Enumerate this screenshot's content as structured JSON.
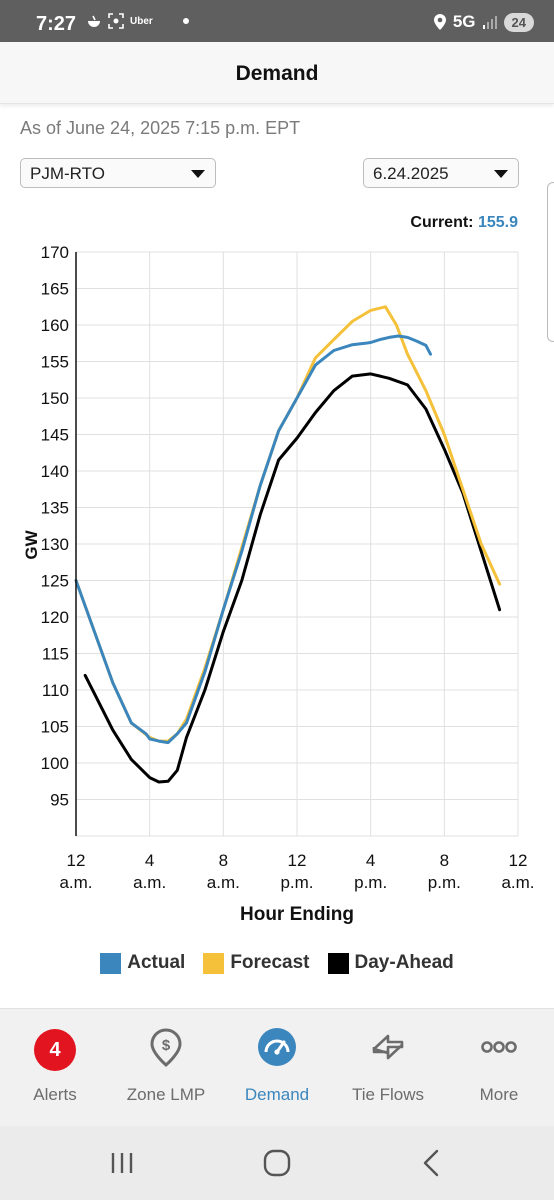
{
  "status_bar": {
    "time": "7:27",
    "uber": "Uber",
    "network": "5G",
    "battery": "24"
  },
  "header": {
    "title": "Demand"
  },
  "as_of": "As of June 24, 2025 7:15 p.m. EPT",
  "filters": {
    "region": "PJM-RTO",
    "date": "6.24.2025"
  },
  "current": {
    "label": "Current:",
    "value": "155.9"
  },
  "chart_data": {
    "type": "line",
    "xlabel": "Hour Ending",
    "ylabel": "GW",
    "ylim": [
      90,
      170
    ],
    "xlim": [
      0,
      24
    ],
    "yticks": [
      95,
      100,
      105,
      110,
      115,
      120,
      125,
      130,
      135,
      140,
      145,
      150,
      155,
      160,
      165,
      170
    ],
    "xticks": [
      {
        "x": 0,
        "line1": "12",
        "line2": "a.m."
      },
      {
        "x": 4,
        "line1": "4",
        "line2": "a.m."
      },
      {
        "x": 8,
        "line1": "8",
        "line2": "a.m."
      },
      {
        "x": 12,
        "line1": "12",
        "line2": "p.m."
      },
      {
        "x": 16,
        "line1": "4",
        "line2": "p.m."
      },
      {
        "x": 20,
        "line1": "8",
        "line2": "p.m."
      },
      {
        "x": 24,
        "line1": "12",
        "line2": "a.m."
      }
    ],
    "grid": true,
    "legend_position": "bottom",
    "series": [
      {
        "name": "Day-Ahead",
        "color": "#000000",
        "points": [
          [
            0.5,
            112
          ],
          [
            1,
            109.5
          ],
          [
            2,
            104.5
          ],
          [
            3,
            100.5
          ],
          [
            4,
            98
          ],
          [
            4.5,
            97.4
          ],
          [
            5,
            97.5
          ],
          [
            5.5,
            99
          ],
          [
            6,
            103.5
          ],
          [
            7,
            110
          ],
          [
            8,
            118
          ],
          [
            9,
            125
          ],
          [
            10,
            134
          ],
          [
            11,
            141.5
          ],
          [
            12,
            144.5
          ],
          [
            13,
            148
          ],
          [
            14,
            151
          ],
          [
            15,
            153
          ],
          [
            16,
            153.3
          ],
          [
            17,
            152.7
          ],
          [
            18,
            151.8
          ],
          [
            19,
            148.5
          ],
          [
            20,
            143
          ],
          [
            21,
            137
          ],
          [
            22,
            129
          ],
          [
            23,
            121
          ]
        ]
      },
      {
        "name": "Forecast",
        "color": "#f5c13a",
        "points": [
          [
            0,
            125
          ],
          [
            1,
            118
          ],
          [
            2,
            111
          ],
          [
            3,
            105.5
          ],
          [
            4,
            103.5
          ],
          [
            4.5,
            103
          ],
          [
            5,
            103
          ],
          [
            5.5,
            104
          ],
          [
            6,
            106
          ],
          [
            7,
            113
          ],
          [
            8,
            121
          ],
          [
            9,
            129.5
          ],
          [
            10,
            138
          ],
          [
            11,
            145.5
          ],
          [
            12,
            150
          ],
          [
            13,
            155.5
          ],
          [
            14,
            158
          ],
          [
            15,
            160.5
          ],
          [
            16,
            162
          ],
          [
            16.8,
            162.5
          ],
          [
            17.4,
            160
          ],
          [
            18,
            156
          ],
          [
            19,
            151
          ],
          [
            20,
            145
          ],
          [
            21,
            137.5
          ],
          [
            22,
            130
          ],
          [
            23,
            124.5
          ]
        ]
      },
      {
        "name": "Actual",
        "color": "#3a86bd",
        "points": [
          [
            0,
            125
          ],
          [
            1,
            118
          ],
          [
            2,
            111
          ],
          [
            3,
            105.5
          ],
          [
            3.8,
            104
          ],
          [
            4,
            103.3
          ],
          [
            4.5,
            103
          ],
          [
            5,
            102.8
          ],
          [
            5.5,
            104
          ],
          [
            6,
            105.5
          ],
          [
            7,
            112.5
          ],
          [
            8,
            121
          ],
          [
            9,
            129
          ],
          [
            10,
            138
          ],
          [
            11,
            145.5
          ],
          [
            12,
            150
          ],
          [
            13,
            154.5
          ],
          [
            14,
            156.5
          ],
          [
            15,
            157.3
          ],
          [
            15.7,
            157.5
          ],
          [
            16,
            157.6
          ],
          [
            16.5,
            158
          ],
          [
            17,
            158.3
          ],
          [
            17.5,
            158.5
          ],
          [
            18,
            158.3
          ],
          [
            18.5,
            157.8
          ],
          [
            19,
            157.2
          ],
          [
            19.25,
            156
          ]
        ]
      }
    ]
  },
  "legend": [
    {
      "label": "Actual",
      "color": "#3a86bd"
    },
    {
      "label": "Forecast",
      "color": "#f5c13a"
    },
    {
      "label": "Day-Ahead",
      "color": "#000000"
    }
  ],
  "bottom_nav": {
    "alerts": {
      "label": "Alerts",
      "badge": "4"
    },
    "zone_lmp": {
      "label": "Zone LMP"
    },
    "demand": {
      "label": "Demand"
    },
    "tie_flows": {
      "label": "Tie Flows"
    },
    "more": {
      "label": "More"
    }
  },
  "colors": {
    "accent": "#3a86bd",
    "badge": "#e2141f",
    "forecast": "#f5c13a"
  }
}
